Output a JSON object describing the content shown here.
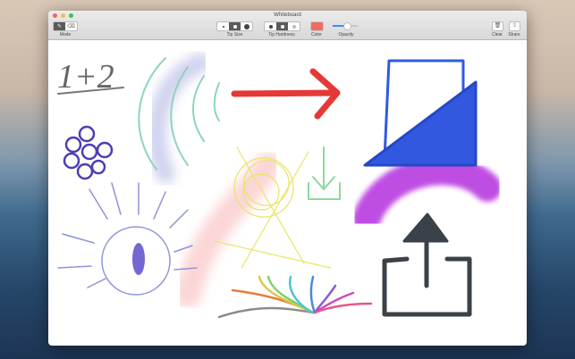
{
  "window": {
    "title": "Whiteboard"
  },
  "toolbar": {
    "mode_label": "Mode",
    "tip_size_label": "Tip Size",
    "tip_hardness_label": "Tip Hardness",
    "color_label": "Color",
    "opacity_label": "Opacity",
    "clear_label": "Clear",
    "share_label": "Share",
    "current_color": "#f26b62",
    "opacity": 0.55
  },
  "canvas": {
    "handwritten_text": "1+2"
  },
  "colors": {
    "close": "#fc605c",
    "minimize": "#fdbc40",
    "zoom": "#34c84a"
  }
}
